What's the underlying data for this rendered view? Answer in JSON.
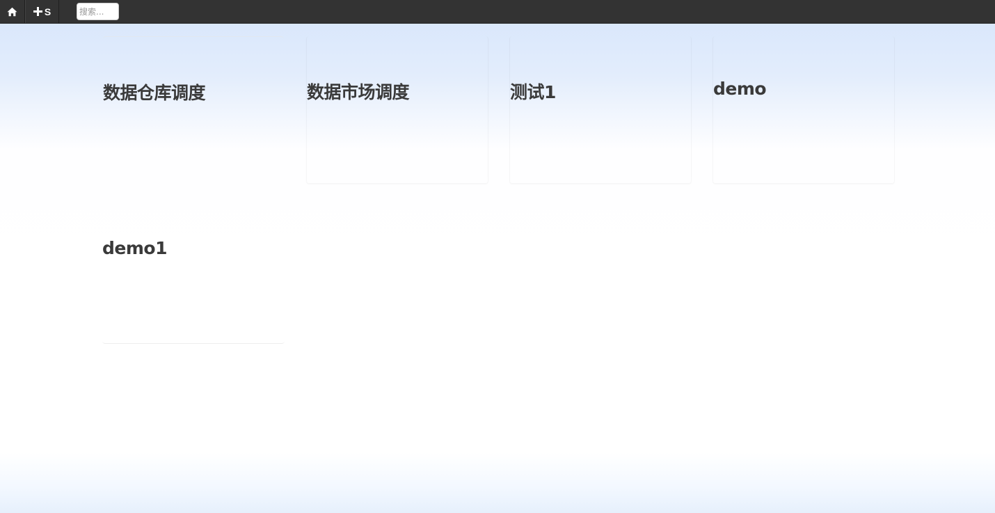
{
  "topbar": {
    "home_icon": "home-icon",
    "add_button": {
      "icon": "plus-icon",
      "label": "S"
    },
    "search": {
      "placeholder": "搜索...",
      "value": ""
    }
  },
  "tiles": [
    {
      "title": "数据仓库调度"
    },
    {
      "title": "数据市场调度"
    },
    {
      "title": "测试1"
    },
    {
      "title": "demo"
    },
    {
      "title": "demo1"
    }
  ],
  "colors": {
    "topbar_bg": "#333333",
    "title_text": "#3a3a3a",
    "gradient_top": "#d6e5fb"
  }
}
